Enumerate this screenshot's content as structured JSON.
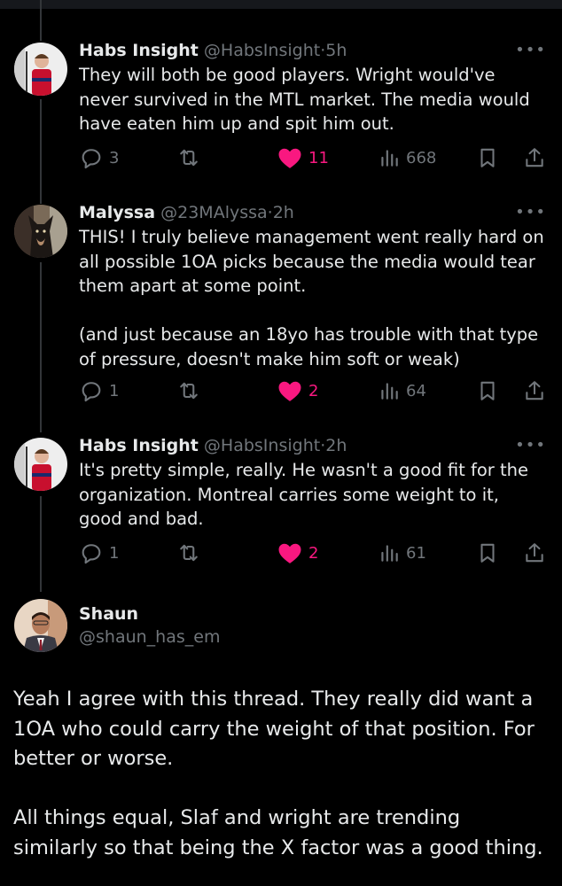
{
  "tweets": [
    {
      "name": "Habs Insight",
      "handle": "@HabsInsight",
      "separator": "·",
      "time": "5h",
      "more": "•••",
      "text": "They will both be good players. Wright would've never survived in the MTL market. The media would have eaten him up and spit him out.",
      "replies": "3",
      "retweets": "",
      "likes": "11",
      "views": "668",
      "liked": true,
      "avatar_icon": "hockey-player-avatar"
    },
    {
      "name": "Malyssa",
      "handle": "@23MAlyssa",
      "separator": "·",
      "time": "2h",
      "more": "•••",
      "text": "THIS! I truly believe management went really hard on all possible 1OA picks because the media would tear them apart at some point.\n\n(and just because an 18yo has trouble with that type of pressure, doesn't make him soft or weak)",
      "replies": "1",
      "retweets": "",
      "likes": "2",
      "views": "64",
      "liked": true,
      "avatar_icon": "dog-avatar"
    },
    {
      "name": "Habs Insight",
      "handle": "@HabsInsight",
      "separator": "·",
      "time": "2h",
      "more": "•••",
      "text": "It's pretty simple, really. He wasn't a good fit for the organization. Montreal carries some weight to it, good and bad.",
      "replies": "1",
      "retweets": "",
      "likes": "2",
      "views": "61",
      "liked": true,
      "avatar_icon": "hockey-player-avatar"
    }
  ],
  "main_tweet": {
    "name": "Shaun",
    "handle": "@shaun_has_em",
    "text": "Yeah I agree with this thread. They really did want a 1OA who could carry the weight of that position. For better or worse.\n\nAll things equal, Slaf and wright are trending similarly so that being the X factor was a good thing.",
    "avatar_icon": "man-in-suit-avatar"
  },
  "colors": {
    "background": "#000000",
    "text": "#e7e9ea",
    "muted": "#71767b",
    "like_pink": "#f91880",
    "thread_line": "#333639"
  }
}
